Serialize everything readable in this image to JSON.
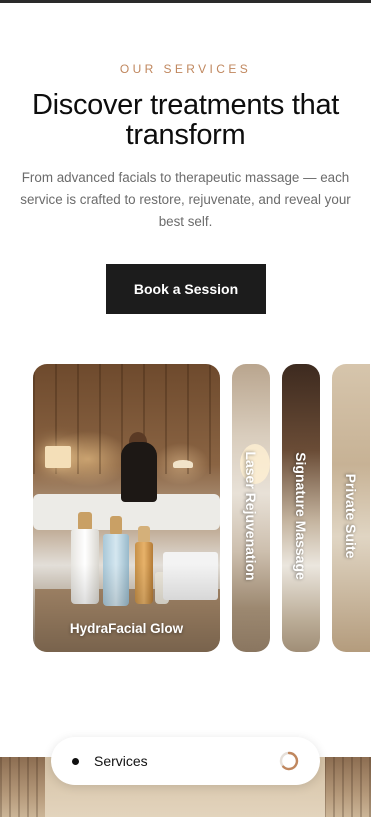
{
  "eyebrow": "OUR SERVICES",
  "title": "Discover treatments that transform",
  "subtitle": "From advanced facials to therapeutic massage — each service is crafted to restore, rejuvenate, and reveal your best self.",
  "cta_label": "Book a Session",
  "services": [
    {
      "label": "HydraFacial Glow"
    },
    {
      "label": "Laser Rejuvenation"
    },
    {
      "label": "Signature Massage"
    },
    {
      "label": "Private Suite"
    }
  ],
  "bottom_nav": {
    "label": "Services",
    "icon": "progress-ring-icon",
    "accent": "#c0875e"
  },
  "colors": {
    "accent": "#c0875e",
    "button_bg": "#1c1c1c"
  }
}
